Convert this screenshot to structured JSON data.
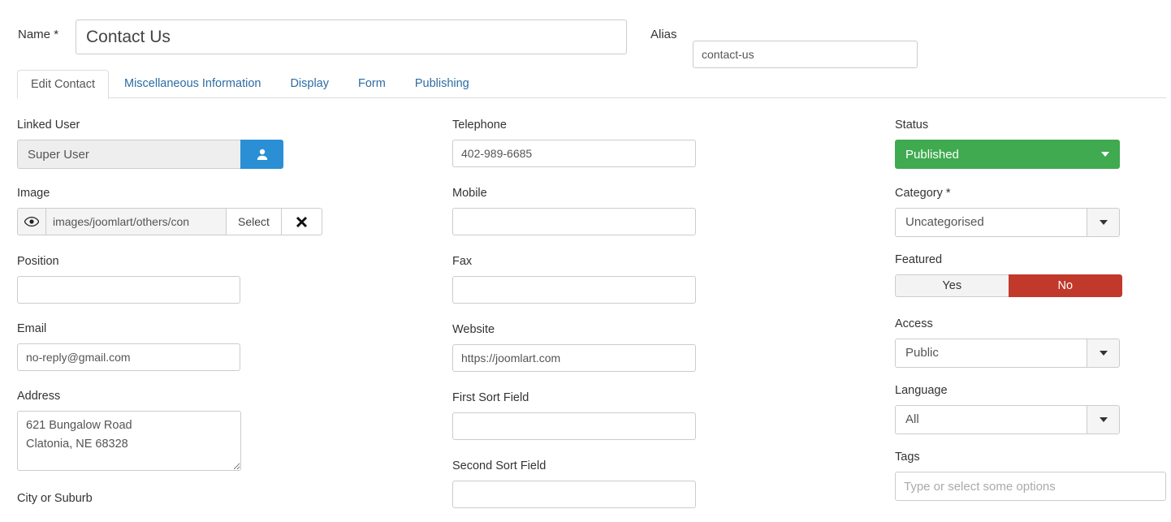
{
  "header": {
    "name_label": "Name",
    "name_required": "*",
    "name_value": "Contact Us",
    "alias_label": "Alias",
    "alias_value": "contact-us"
  },
  "tabs": [
    {
      "label": "Edit Contact",
      "active": true
    },
    {
      "label": "Miscellaneous Information",
      "active": false
    },
    {
      "label": "Display",
      "active": false
    },
    {
      "label": "Form",
      "active": false
    },
    {
      "label": "Publishing",
      "active": false
    }
  ],
  "left_column": {
    "linked_user": {
      "label": "Linked User",
      "value": "Super User",
      "button_icon": "user-icon"
    },
    "image": {
      "label": "Image",
      "preview_icon": "eye-icon",
      "path": "images/joomlart/others/con",
      "select_label": "Select",
      "clear_icon": "close-x-icon"
    },
    "position": {
      "label": "Position",
      "value": ""
    },
    "email": {
      "label": "Email",
      "value": "no-reply@gmail.com"
    },
    "address": {
      "label": "Address",
      "value": "621 Bungalow Road\nClatonia, NE 68328"
    },
    "city": {
      "label": "City or Suburb"
    }
  },
  "middle_column": {
    "telephone": {
      "label": "Telephone",
      "value": "402-989-6685"
    },
    "mobile": {
      "label": "Mobile",
      "value": ""
    },
    "fax": {
      "label": "Fax",
      "value": ""
    },
    "website": {
      "label": "Website",
      "value": "https://joomlart.com"
    },
    "first_sort": {
      "label": "First Sort Field",
      "value": ""
    },
    "second_sort": {
      "label": "Second Sort Field",
      "value": ""
    }
  },
  "right_column": {
    "status": {
      "label": "Status",
      "value": "Published",
      "color": "#3faa4f"
    },
    "category": {
      "label": "Category",
      "required": "*",
      "value": "Uncategorised"
    },
    "featured": {
      "label": "Featured",
      "yes_label": "Yes",
      "no_label": "No",
      "selected": "No",
      "active_color": "#c0392b"
    },
    "access": {
      "label": "Access",
      "value": "Public"
    },
    "language": {
      "label": "Language",
      "value": "All"
    },
    "tags": {
      "label": "Tags",
      "placeholder": "Type or select some options",
      "value": ""
    }
  }
}
